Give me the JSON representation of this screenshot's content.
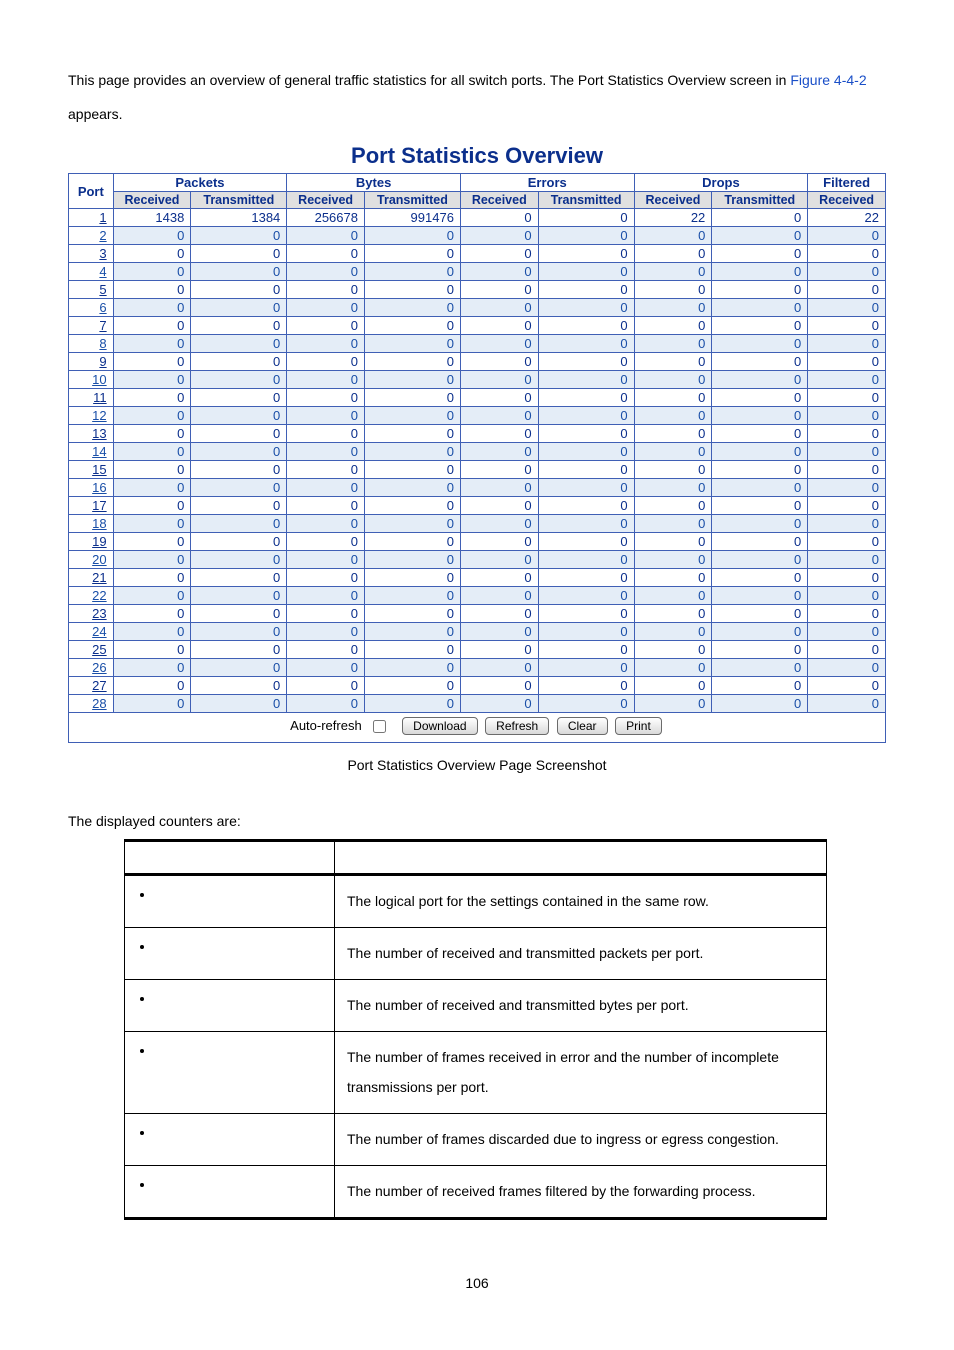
{
  "intro": {
    "prefix": "This page provides an overview of general traffic statistics for all switch ports. The Port Statistics Overview screen in ",
    "figure_link": "Figure 4-4-2",
    "suffix": " appears."
  },
  "overview_title": "Port Statistics Overview",
  "columns": {
    "port": "Port",
    "groups": [
      "Packets",
      "Bytes",
      "Errors",
      "Drops",
      "Filtered"
    ],
    "subs": [
      "Received",
      "Transmitted",
      "Received",
      "Transmitted",
      "Received",
      "Transmitted",
      "Received",
      "Transmitted",
      "Received"
    ]
  },
  "rows": [
    {
      "port": "1",
      "v": [
        "1438",
        "1384",
        "256678",
        "991476",
        "0",
        "0",
        "22",
        "0",
        "22"
      ]
    },
    {
      "port": "2",
      "v": [
        "0",
        "0",
        "0",
        "0",
        "0",
        "0",
        "0",
        "0",
        "0"
      ]
    },
    {
      "port": "3",
      "v": [
        "0",
        "0",
        "0",
        "0",
        "0",
        "0",
        "0",
        "0",
        "0"
      ]
    },
    {
      "port": "4",
      "v": [
        "0",
        "0",
        "0",
        "0",
        "0",
        "0",
        "0",
        "0",
        "0"
      ]
    },
    {
      "port": "5",
      "v": [
        "0",
        "0",
        "0",
        "0",
        "0",
        "0",
        "0",
        "0",
        "0"
      ]
    },
    {
      "port": "6",
      "v": [
        "0",
        "0",
        "0",
        "0",
        "0",
        "0",
        "0",
        "0",
        "0"
      ]
    },
    {
      "port": "7",
      "v": [
        "0",
        "0",
        "0",
        "0",
        "0",
        "0",
        "0",
        "0",
        "0"
      ]
    },
    {
      "port": "8",
      "v": [
        "0",
        "0",
        "0",
        "0",
        "0",
        "0",
        "0",
        "0",
        "0"
      ]
    },
    {
      "port": "9",
      "v": [
        "0",
        "0",
        "0",
        "0",
        "0",
        "0",
        "0",
        "0",
        "0"
      ]
    },
    {
      "port": "10",
      "v": [
        "0",
        "0",
        "0",
        "0",
        "0",
        "0",
        "0",
        "0",
        "0"
      ]
    },
    {
      "port": "11",
      "v": [
        "0",
        "0",
        "0",
        "0",
        "0",
        "0",
        "0",
        "0",
        "0"
      ]
    },
    {
      "port": "12",
      "v": [
        "0",
        "0",
        "0",
        "0",
        "0",
        "0",
        "0",
        "0",
        "0"
      ]
    },
    {
      "port": "13",
      "v": [
        "0",
        "0",
        "0",
        "0",
        "0",
        "0",
        "0",
        "0",
        "0"
      ]
    },
    {
      "port": "14",
      "v": [
        "0",
        "0",
        "0",
        "0",
        "0",
        "0",
        "0",
        "0",
        "0"
      ]
    },
    {
      "port": "15",
      "v": [
        "0",
        "0",
        "0",
        "0",
        "0",
        "0",
        "0",
        "0",
        "0"
      ]
    },
    {
      "port": "16",
      "v": [
        "0",
        "0",
        "0",
        "0",
        "0",
        "0",
        "0",
        "0",
        "0"
      ]
    },
    {
      "port": "17",
      "v": [
        "0",
        "0",
        "0",
        "0",
        "0",
        "0",
        "0",
        "0",
        "0"
      ]
    },
    {
      "port": "18",
      "v": [
        "0",
        "0",
        "0",
        "0",
        "0",
        "0",
        "0",
        "0",
        "0"
      ]
    },
    {
      "port": "19",
      "v": [
        "0",
        "0",
        "0",
        "0",
        "0",
        "0",
        "0",
        "0",
        "0"
      ]
    },
    {
      "port": "20",
      "v": [
        "0",
        "0",
        "0",
        "0",
        "0",
        "0",
        "0",
        "0",
        "0"
      ]
    },
    {
      "port": "21",
      "v": [
        "0",
        "0",
        "0",
        "0",
        "0",
        "0",
        "0",
        "0",
        "0"
      ]
    },
    {
      "port": "22",
      "v": [
        "0",
        "0",
        "0",
        "0",
        "0",
        "0",
        "0",
        "0",
        "0"
      ]
    },
    {
      "port": "23",
      "v": [
        "0",
        "0",
        "0",
        "0",
        "0",
        "0",
        "0",
        "0",
        "0"
      ]
    },
    {
      "port": "24",
      "v": [
        "0",
        "0",
        "0",
        "0",
        "0",
        "0",
        "0",
        "0",
        "0"
      ]
    },
    {
      "port": "25",
      "v": [
        "0",
        "0",
        "0",
        "0",
        "0",
        "0",
        "0",
        "0",
        "0"
      ]
    },
    {
      "port": "26",
      "v": [
        "0",
        "0",
        "0",
        "0",
        "0",
        "0",
        "0",
        "0",
        "0"
      ]
    },
    {
      "port": "27",
      "v": [
        "0",
        "0",
        "0",
        "0",
        "0",
        "0",
        "0",
        "0",
        "0"
      ]
    },
    {
      "port": "28",
      "v": [
        "0",
        "0",
        "0",
        "0",
        "0",
        "0",
        "0",
        "0",
        "0"
      ]
    }
  ],
  "controls": {
    "auto_refresh": "Auto-refresh",
    "download": "Download",
    "refresh": "Refresh",
    "clear": "Clear",
    "print": "Print"
  },
  "caption": "Port Statistics Overview Page Screenshot",
  "displayed_text": "The displayed counters are:",
  "desc_rows": [
    {
      "label": "",
      "text": "The logical port for the settings contained in the same row."
    },
    {
      "label": "",
      "text": "The number of received and transmitted packets per port."
    },
    {
      "label": "",
      "text": "The number of received and transmitted bytes per port."
    },
    {
      "label": "",
      "text": "The number of frames received in error and the number of incomplete transmissions per port."
    },
    {
      "label": "",
      "text": "The number of frames discarded due to ingress or egress congestion."
    },
    {
      "label": "",
      "text": "The number of received frames filtered by the forwarding process."
    }
  ],
  "page_number": "106"
}
